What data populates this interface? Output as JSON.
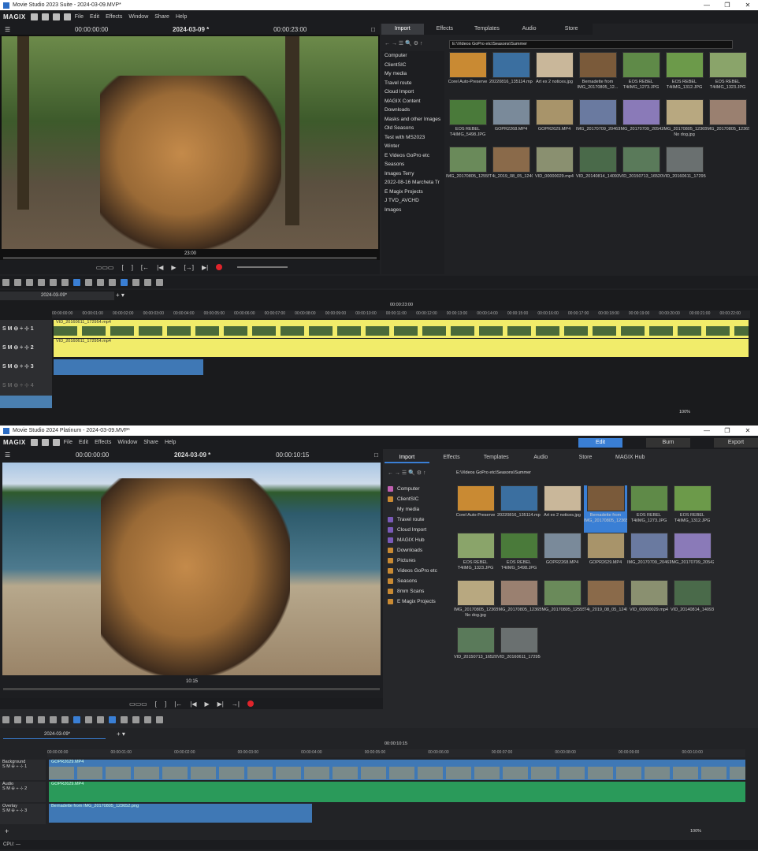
{
  "app1": {
    "title": "Movie Studio 2023 Suite - 2024-03-09.MVP*",
    "logo": "MAGIX",
    "menu": [
      "File",
      "Edit",
      "Effects",
      "Window",
      "Share",
      "Help"
    ],
    "viewer": {
      "timecode_left": "00:00:00:00",
      "project": "2024-03-09 *",
      "timecode_right": "00:00:23:00",
      "marker": "23:00"
    },
    "tabs": [
      "Import",
      "Effects",
      "Templates",
      "Audio",
      "Store"
    ],
    "path": "E:\\Videos GoPro  etc\\Seasons\\Summer",
    "folders": [
      "Computer",
      "ClientSIC",
      "My media",
      "Travel route",
      "Cloud Import",
      "MAGIX Content",
      "Downloads",
      "Masks and other Images",
      "Old Seasons",
      "Test with MS2023",
      "Winter",
      "E Videos GoPro  etc",
      "Seasons",
      "Images Terry",
      "2022-08-16 Marcheta Tr",
      "E Magix Projects",
      "J TVD_AVCHD",
      "Images"
    ],
    "files": [
      "Corel Auto-Preserve",
      "20220816_135114.mp4",
      "Art ex 2 notices.jpg",
      "Bernadette from IMG_20170805_12...",
      "EOS REBEL T4iIMG_1273.JPG",
      "EOS REBEL T4iIMG_1312.JPG",
      "EOS REBEL T4iIMG_1323.JPG",
      "EOS REBEL T4iIMG_5498.JPG",
      "GOPR2268.MP4",
      "GOPR2629.MP4",
      "IMG_20170709_204613.jpg",
      "IMG_20170709_205420.jpg",
      "IMG_20170805_123652 No dog.jpg",
      "IMG_20170805_123652.jpg",
      "IMG_20170805_125552_hdr.jpg",
      "T4i_2019_08_05_1240.MOV",
      "VID_00000029.mp4",
      "VID_20140814_140934.mp4",
      "VID_20150713_165208.mp4",
      "VID_20160611_172954.mp4"
    ],
    "timeline": {
      "tab": "2024-03-09*",
      "marker": "00:00:23:00",
      "clip1": "VID_20160611_172954.mp4",
      "clip2": "VID_20160611_172954.mp4",
      "zoom": "100%"
    },
    "ruler_labels": [
      "00:00:00:00",
      "00:00:01:00",
      "00:00:02:00",
      "00:00:03:00",
      "00:00:04:00",
      "00:00:05:00",
      "00:00:06:00",
      "00:00:07:00",
      "00:00:08:00",
      "00:00:09:00",
      "00:00:10:00",
      "00:00:11:00",
      "00:00:12:00",
      "00:00:13:00",
      "00:00:14:00",
      "00:00:15:00",
      "00:00:16:00",
      "00:00:17:00",
      "00:00:18:00",
      "00:00:19:00",
      "00:00:20:00",
      "00:00:21:00",
      "00:00:22:00"
    ]
  },
  "app2": {
    "title": "Movie Studio 2024 Platinum - 2024-03-09.MVP*",
    "logo": "MAGIX",
    "menu": [
      "File",
      "Edit",
      "Effects",
      "Window",
      "Share",
      "Help"
    ],
    "modes": [
      "Edit",
      "Burn",
      "Export"
    ],
    "viewer": {
      "timecode_left": "00:00:00:00",
      "project": "2024-03-09 *",
      "timecode_right": "00:00:10:15",
      "marker": "10:15"
    },
    "tabs": [
      "Import",
      "Effects",
      "Templates",
      "Audio",
      "Store",
      "MAGIX Hub"
    ],
    "path": "E:\\Videos GoPro  etc\\Seasons\\Summer",
    "folders": [
      "Computer",
      "ClientSIC",
      "My media",
      "Travel route",
      "Cloud Import",
      "MAGIX Hub",
      "Downloads",
      "Pictures",
      "Videos GoPro  etc",
      "Seasons",
      "8mm Scans",
      "E Magix Projects"
    ],
    "files": [
      "Corel Auto-Preserve",
      "20220816_135114.mp4",
      "Art ex 2 notices.jpg",
      "Bernadette from IMG_20170805_123652.png",
      "EOS REBEL T4iIMG_1273.JPG",
      "EOS REBEL T4iIMG_1312.JPG",
      "EOS REBEL T4iIMG_1323.JPG",
      "EOS REBEL T4iIMG_5498.JPG",
      "GOPR2268.MP4",
      "GOPR2629.MP4",
      "IMG_20170709_204613.jpg",
      "IMG_20170709_205420.jpg",
      "IMG_20170805_123652 No dog.jpg",
      "IMG_20170805_123652.jpg",
      "IMG_20170805_125552_hdr.jpg",
      "T4i_2019_08_05_1240.MOV",
      "VID_00000029.mp4",
      "VID_20140814_140934.mp4",
      "VID_20150713_165208.mp4",
      "VID_20160611_172954.mp4"
    ],
    "timeline": {
      "tab": "2024-03-09*",
      "marker": "00:00:10:15",
      "track1": "Background",
      "track2": "Audio",
      "track3": "Overlay",
      "clip1": "GOPR2629.MP4",
      "clip2": "GOPR2629.MP4",
      "clip3": "Bernadette from IMG_20170805_123652.png",
      "zoom": "100%"
    },
    "ruler_labels": [
      "00:00:00:00",
      "00:00:01:00",
      "00:00:02:00",
      "00:00:03:00",
      "00:00:04:00",
      "00:00:05:00",
      "00:00:06:00",
      "00:00:07:00",
      "00:00:08:00",
      "00:00:09:00",
      "00:00:10:00"
    ],
    "status": "CPU: —"
  },
  "colors": {
    "accent": "#3a7fd5",
    "clip_yellow": "#f1ec6a",
    "clip_blue": "#3f78b5",
    "clip_green": "#2a9a5a",
    "record": "#e0242b"
  }
}
